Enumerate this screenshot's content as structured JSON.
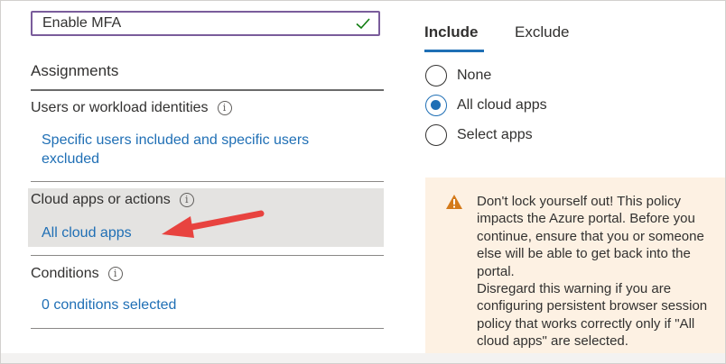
{
  "policy_name": {
    "value": "Enable MFA"
  },
  "assignments": {
    "heading": "Assignments",
    "users": {
      "label": "Users or workload identities",
      "link_lines": [
        "Specific users included and specific users",
        "excluded"
      ]
    },
    "cloud_apps": {
      "label": "Cloud apps or actions",
      "link": "All cloud apps"
    },
    "conditions": {
      "label": "Conditions",
      "link": "0 conditions selected"
    }
  },
  "tabs": {
    "include": "Include",
    "exclude": "Exclude",
    "selected": "include"
  },
  "radio_options": [
    {
      "label": "None",
      "checked": false
    },
    {
      "label": "All cloud apps",
      "checked": true
    },
    {
      "label": "Select apps",
      "checked": false
    }
  ],
  "warning": {
    "lines": [
      "Don't lock yourself out! This policy",
      "impacts the Azure portal. Before you",
      "continue, ensure that you or someone",
      "else will be able to get back into the",
      "portal.",
      "Disregard this warning if you are",
      "configuring persistent browser session",
      "policy that works correctly only if \"All",
      "cloud apps\" are selected."
    ]
  },
  "colors": {
    "accent": "#1f6fb5",
    "input_border": "#7a5c9b",
    "check": "#107c10",
    "warning_bg": "#fdf1e3",
    "warning_icon": "#d47a1a",
    "arrow": "#e8433f",
    "highlight": "#e4e3e1"
  },
  "icons": [
    "check-icon",
    "info-icon",
    "warning-icon",
    "red-arrow"
  ]
}
